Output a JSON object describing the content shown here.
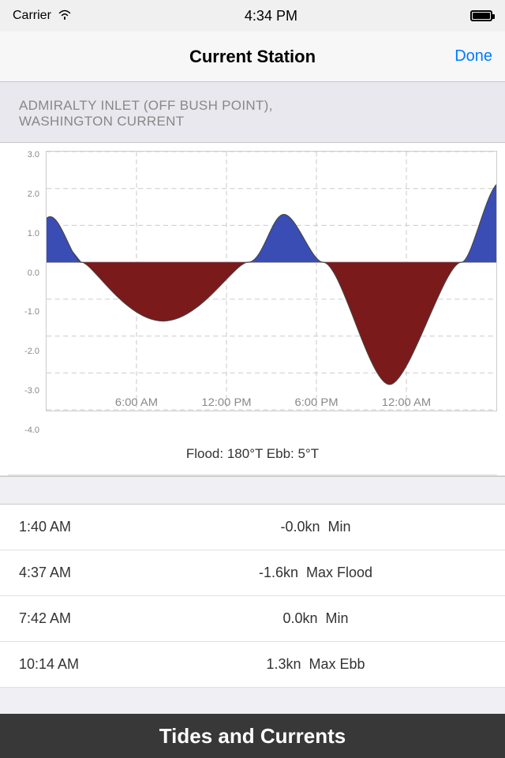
{
  "status": {
    "carrier": "Carrier",
    "time": "4:34 PM",
    "wifi_icon": "wifi",
    "battery_icon": "battery"
  },
  "nav": {
    "title": "Current Station",
    "done_label": "Done"
  },
  "station": {
    "name": "ADMIRALTY INLET (OFF BUSH POINT),\nWASHINGTON CURRENT"
  },
  "chart": {
    "y_labels": [
      "3.0",
      "2.0",
      "1.0",
      "0.0",
      "-1.0",
      "-2.0",
      "-3.0",
      "-4.0"
    ],
    "x_labels": [
      "6:00 AM",
      "12:00 PM",
      "6:00 PM",
      "12:00 AM"
    ]
  },
  "info": {
    "flood_ebb": "Flood: 180°T    Ebb: 5°T"
  },
  "rows": [
    {
      "time": "1:40 AM",
      "value": "-0.0kn  Min"
    },
    {
      "time": "4:37 AM",
      "value": "-1.6kn  Max Flood"
    },
    {
      "time": "7:42 AM",
      "value": "0.0kn  Min"
    },
    {
      "time": "10:14 AM",
      "value": "1.3kn  Max Ebb"
    }
  ],
  "app_banner": {
    "text": "Tides and Currents"
  }
}
